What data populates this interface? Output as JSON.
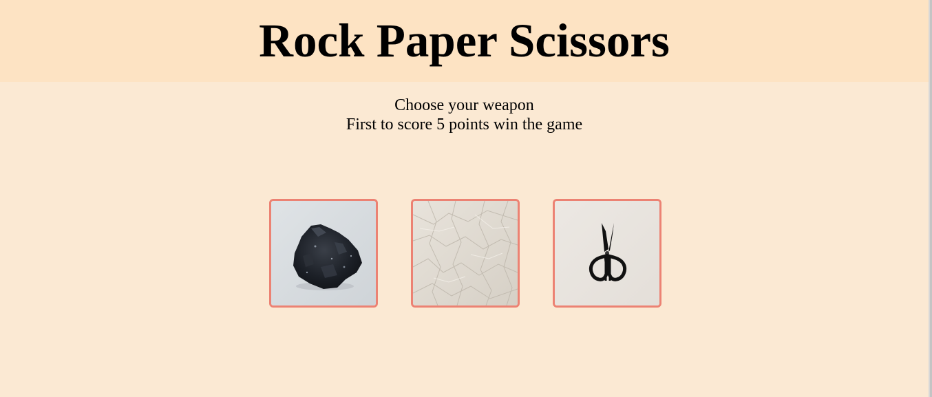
{
  "header": {
    "title": "Rock Paper Scissors",
    "background": "#fde3c3"
  },
  "instructions": {
    "line1": "Choose your weapon",
    "line2": "First to score 5 points win the game"
  },
  "choices": [
    {
      "id": "rock",
      "icon": "rock-image"
    },
    {
      "id": "paper",
      "icon": "crumpled-paper-image"
    },
    {
      "id": "scissors",
      "icon": "scissors-image"
    }
  ],
  "colors": {
    "page_background": "#fbe9d3",
    "choice_border": "#ec8273"
  }
}
